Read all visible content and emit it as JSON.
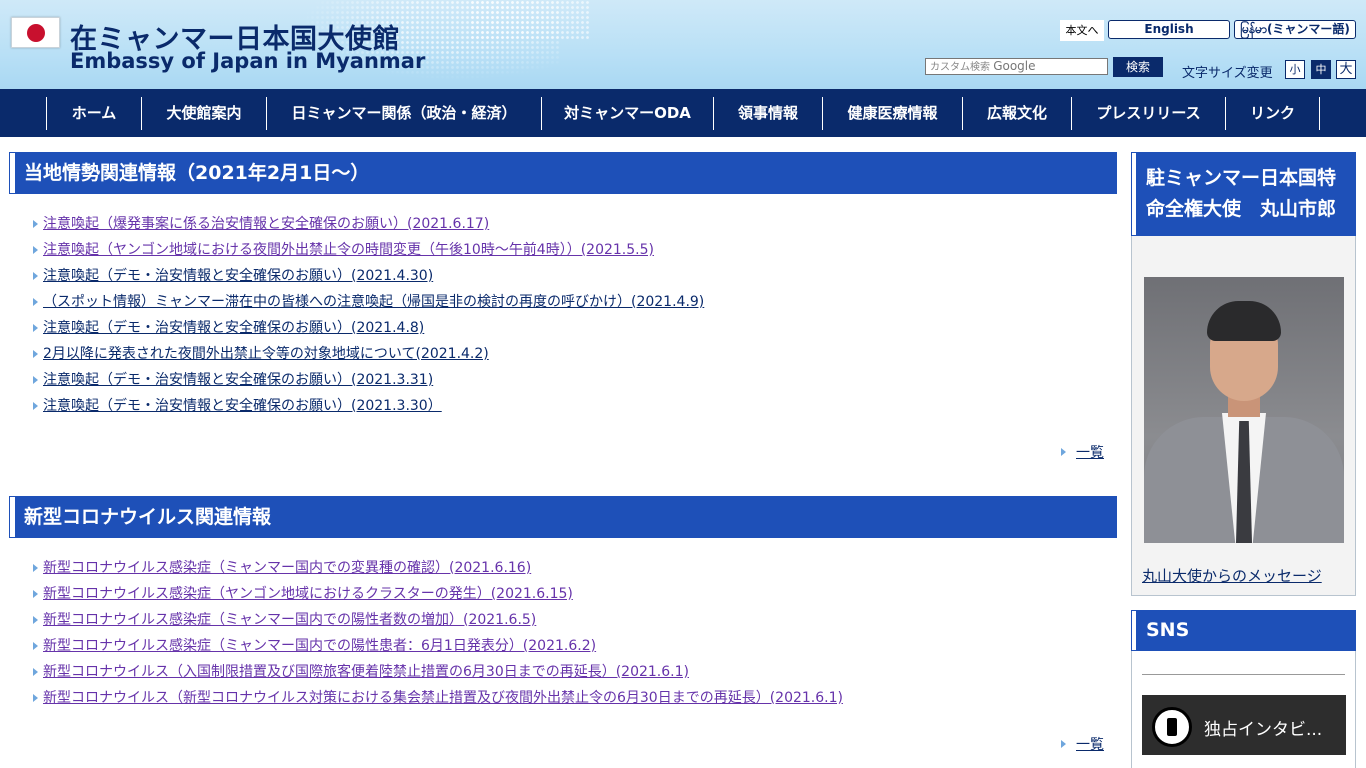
{
  "header": {
    "title_ja": "在ミャンマー日本国大使館",
    "title_en": "Embassy of Japan in Myanmar",
    "skip_to_main": "本文へ",
    "lang_english": "English",
    "lang_myanmar": "မြန်မာ(ミャンマー語)",
    "search_placeholder": "カスタム検索",
    "search_brand": "Google",
    "search_button": "検索",
    "font_size_label": "文字サイズ変更",
    "font_small": "小",
    "font_medium": "中",
    "font_large": "大",
    "font_size_selected": "中"
  },
  "nav": {
    "items": [
      {
        "label": "ホーム"
      },
      {
        "label": "大使館案内"
      },
      {
        "label": "日ミャンマー関係（政治・経済）"
      },
      {
        "label": "対ミャンマーODA"
      },
      {
        "label": "領事情報"
      },
      {
        "label": "健康医療情報"
      },
      {
        "label": "広報文化"
      },
      {
        "label": "プレスリリース"
      },
      {
        "label": "リンク"
      }
    ]
  },
  "sections": [
    {
      "title": "当地情勢関連情報（2021年2月1日〜）",
      "items": [
        {
          "text": "注意喚起（爆発事案に係る治安情報と安全確保のお願い）(2021.6.17)",
          "visited": true
        },
        {
          "text": "注意喚起（ヤンゴン地域における夜間外出禁止令の時間変更（午後10時〜午前4時））(2021.5.5)",
          "visited": true
        },
        {
          "text": "注意喚起（デモ・治安情報と安全確保のお願い）(2021.4.30)",
          "visited": false
        },
        {
          "text": "（スポット情報）ミャンマー滞在中の皆様への注意喚起（帰国是非の検討の再度の呼びかけ）(2021.4.9)",
          "visited": false
        },
        {
          "text": "注意喚起（デモ・治安情報と安全確保のお願い）(2021.4.8)",
          "visited": false
        },
        {
          "text": "2月以降に発表された夜間外出禁止令等の対象地域について(2021.4.2)",
          "visited": false
        },
        {
          "text": "注意喚起（デモ・治安情報と安全確保のお願い）(2021.3.31)",
          "visited": false
        },
        {
          "text": "注意喚起（デモ・治安情報と安全確保のお願い）(2021.3.30）",
          "visited": false
        }
      ],
      "more": "一覧"
    },
    {
      "title": "新型コロナウイルス関連情報",
      "items": [
        {
          "text": "新型コロナウイルス感染症（ミャンマー国内での変異種の確認）(2021.6.16)",
          "visited": true
        },
        {
          "text": "新型コロナウイルス感染症（ヤンゴン地域におけるクラスターの発生）(2021.6.15)",
          "visited": true
        },
        {
          "text": "新型コロナウイルス感染症（ミャンマー国内での陽性者数の増加）(2021.6.5)",
          "visited": true
        },
        {
          "text": "新型コロナウイルス感染症（ミャンマー国内での陽性患者：6月1日発表分）(2021.6.2)",
          "visited": true
        },
        {
          "text": "新型コロナウイルス（入国制限措置及び国際旅客便着陸禁止措置の6月30日までの再延長）(2021.6.1)",
          "visited": true
        },
        {
          "text": "新型コロナウイルス（新型コロナウイルス対策における集会禁止措置及び夜間外出禁止令の6月30日までの再延長）(2021.6.1)",
          "visited": true
        }
      ],
      "more": "一覧"
    }
  ],
  "sidebar": {
    "ambassador_heading": "駐ミャンマー日本国特命全権大使　丸山市郎",
    "ambassador_message_link": "丸山大使からのメッセージ",
    "sns_heading": "SNS",
    "video_title": "独占インタビ..."
  },
  "colors": {
    "navy": "#0a2a6b",
    "section_blue": "#1e50b8",
    "visited_link": "#6633aa"
  }
}
